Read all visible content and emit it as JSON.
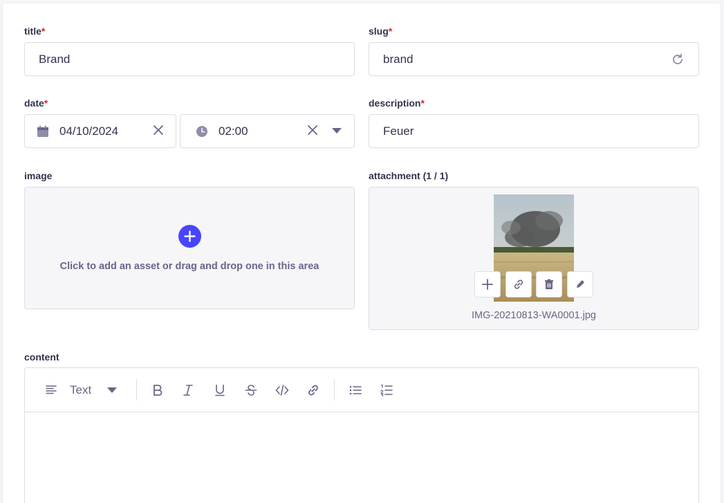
{
  "fields": {
    "title": {
      "label": "title",
      "required_mark": "*",
      "value": "Brand"
    },
    "slug": {
      "label": "slug",
      "required_mark": "*",
      "value": "brand"
    },
    "date": {
      "label": "date",
      "required_mark": "*",
      "date_value": "04/10/2024",
      "time_value": "02:00"
    },
    "description": {
      "label": "description",
      "required_mark": "*",
      "value": "Feuer"
    },
    "image": {
      "label": "image",
      "dropzone_text": "Click to add an asset or drag and drop one in this area"
    },
    "attachment": {
      "label": "attachment (1 / 1)",
      "file_name": "IMG-20210813-WA0001.jpg"
    },
    "content": {
      "label": "content",
      "block_type": "Text"
    }
  },
  "icons": {
    "slug_regenerate": "refresh-icon",
    "date": "calendar-icon",
    "time": "clock-icon",
    "clear": "close-icon",
    "dropdown": "caret-down-icon",
    "add_asset": "plus-circle-icon",
    "toolbar": [
      "align-left-icon",
      "bold-icon",
      "italic-icon",
      "underline-icon",
      "strikethrough-icon",
      "code-icon",
      "link-icon",
      "bulleted-list-icon",
      "numbered-list-icon"
    ],
    "asset_actions": [
      "plus-icon",
      "link-icon",
      "trash-icon",
      "pencil-icon"
    ]
  },
  "colors": {
    "primary": "#4945ff",
    "required": "#d02b20",
    "border": "#dcdce4",
    "icon": "#8e8ea9",
    "text": "#32324d"
  }
}
